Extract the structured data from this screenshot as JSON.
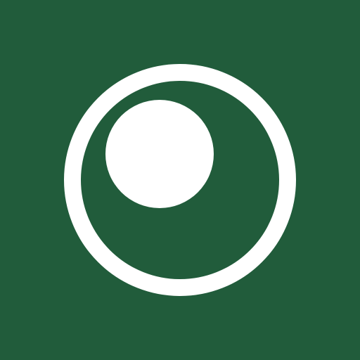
{
  "icon": {
    "name": "circle-with-dot-icon",
    "colors": {
      "background": "#215c3b",
      "foreground": "#ffffff"
    }
  }
}
